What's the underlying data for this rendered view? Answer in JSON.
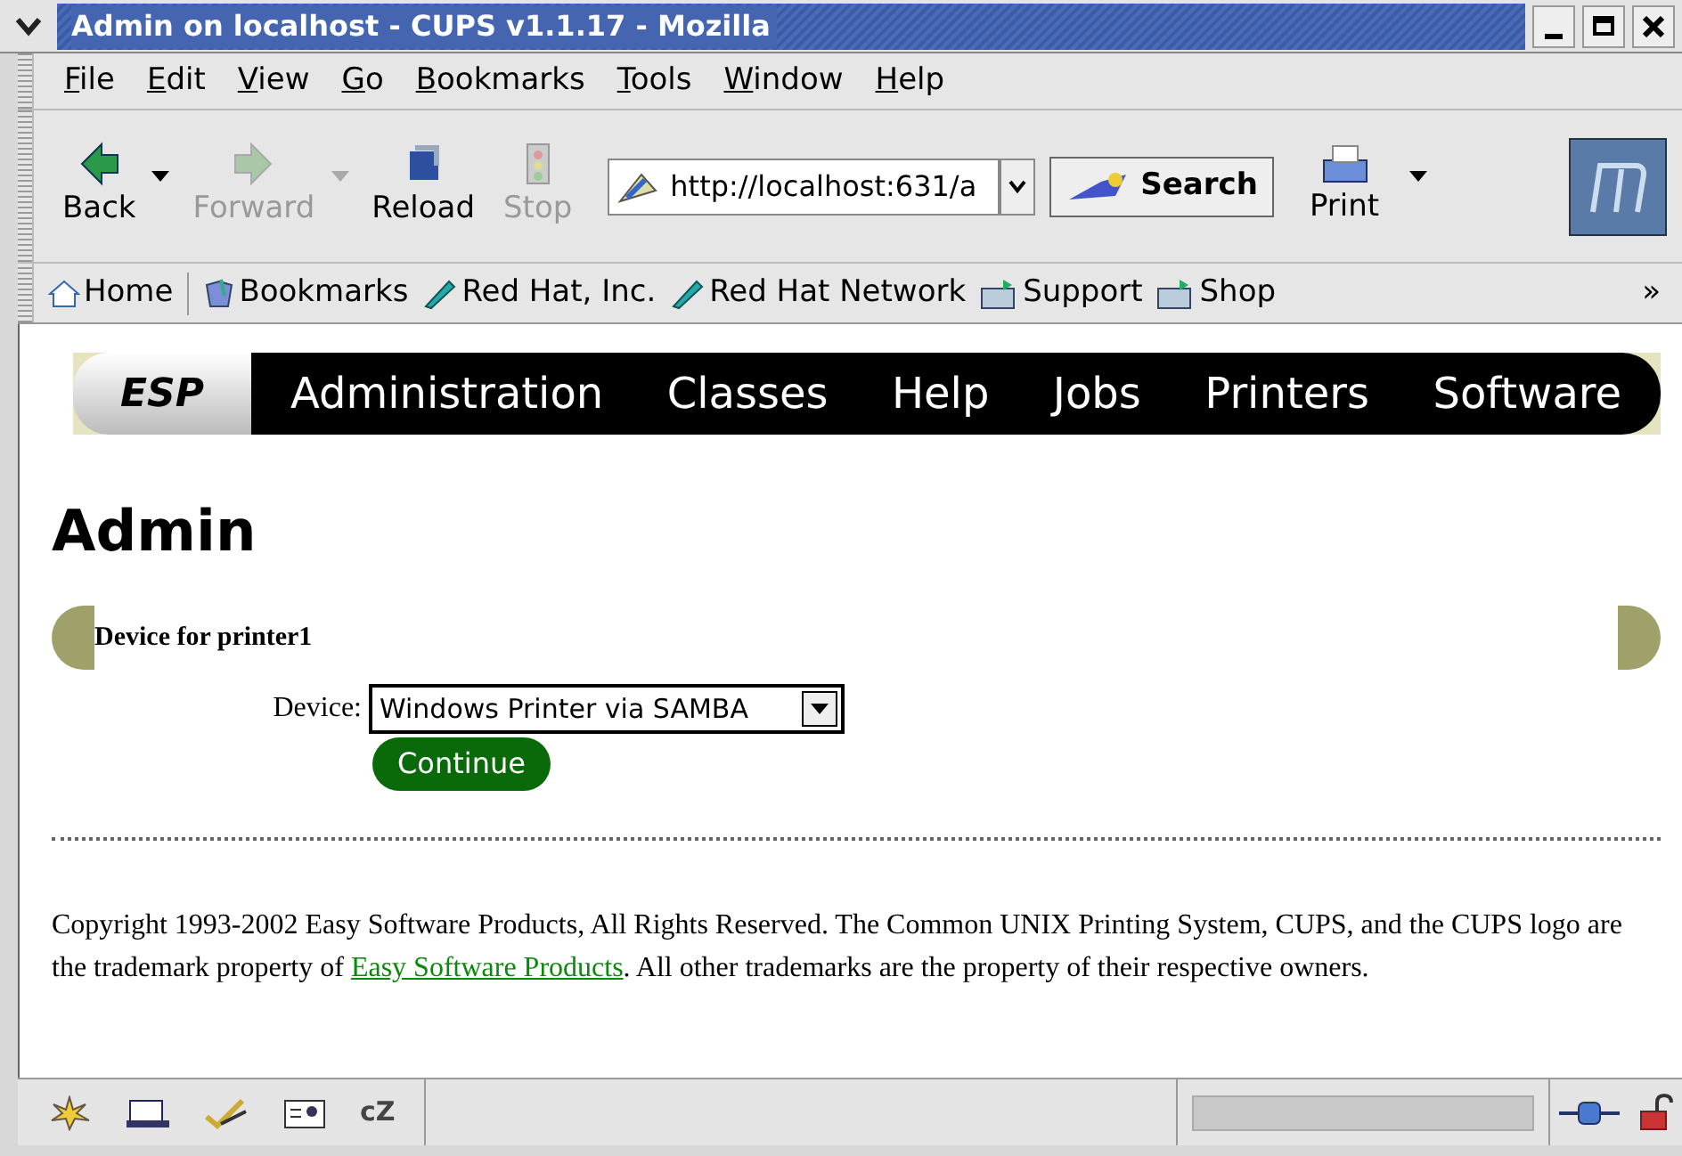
{
  "window": {
    "title": "Admin on localhost - CUPS v1.1.17 - Mozilla"
  },
  "menu": [
    "File",
    "Edit",
    "View",
    "Go",
    "Bookmarks",
    "Tools",
    "Window",
    "Help"
  ],
  "toolbar": [
    {
      "label": "Back",
      "disabled": false,
      "dropdown": true
    },
    {
      "label": "Forward",
      "disabled": true,
      "dropdown": true
    },
    {
      "label": "Reload",
      "disabled": false,
      "dropdown": false
    },
    {
      "label": "Stop",
      "disabled": true,
      "dropdown": false
    }
  ],
  "url": "http://localhost:631/a",
  "search_button": "Search",
  "print_button": "Print",
  "bookmarks_bar": {
    "items": [
      {
        "label": "Home",
        "kind": "home"
      },
      {
        "label": "Bookmarks",
        "kind": "bookmarks"
      },
      {
        "label": "Red Hat, Inc.",
        "kind": "link"
      },
      {
        "label": "Red Hat Network",
        "kind": "link"
      },
      {
        "label": "Support",
        "kind": "folder"
      },
      {
        "label": "Shop",
        "kind": "folder"
      }
    ],
    "overflow": "»"
  },
  "page": {
    "nav": {
      "logo": "ESP",
      "items": [
        "Administration",
        "Classes",
        "Help",
        "Jobs",
        "Printers",
        "Software"
      ]
    },
    "heading": "Admin",
    "section_title": "Device for printer1",
    "device_label": "Device:",
    "device_value": "Windows Printer via SAMBA",
    "continue_button": "Continue",
    "footer": {
      "before": "Copyright 1993-2002 Easy Software Products, All Rights Reserved. The Common UNIX Printing System, CUPS, and the CUPS logo are the trademark property of ",
      "link": "Easy Software Products",
      "after": ". All other trademarks are the property of their respective owners."
    }
  },
  "status_bar": {
    "component_icon_text": "cZ"
  }
}
